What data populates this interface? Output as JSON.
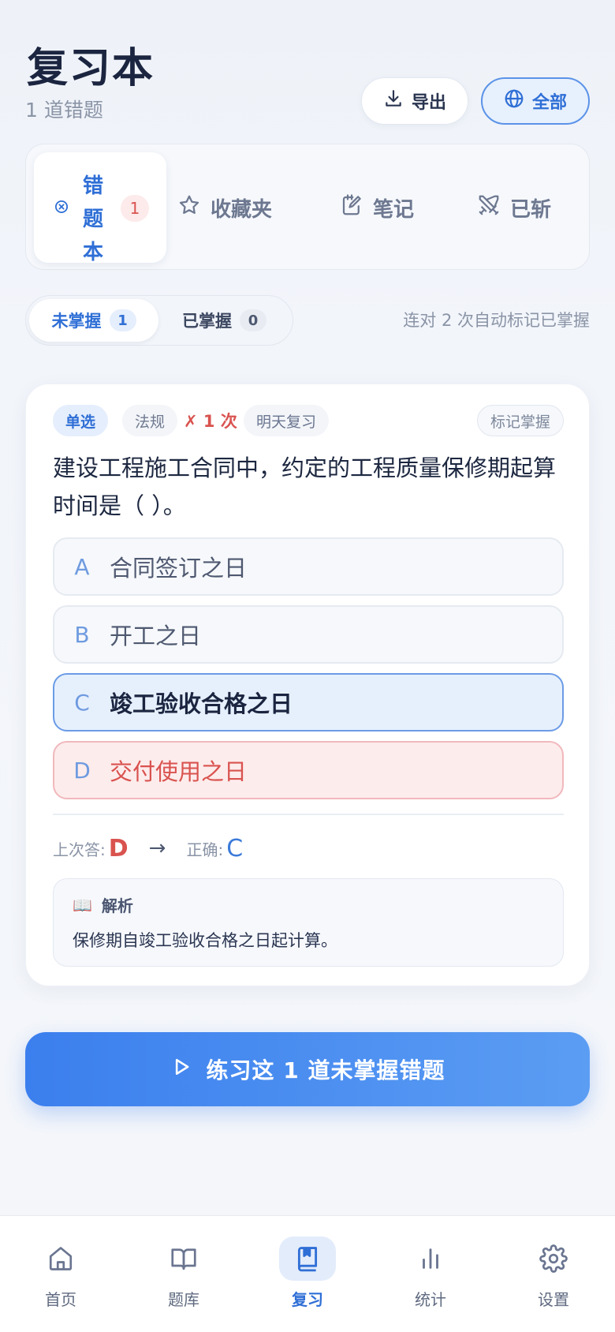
{
  "header": {
    "title": "复习本",
    "subtitle": "1 道错题",
    "export_label": "导出",
    "scope_label": "全部"
  },
  "tabs": [
    {
      "label": "错题本",
      "count": "1",
      "icon": "x-circle-icon",
      "active": true
    },
    {
      "label": "收藏夹",
      "icon": "star-icon"
    },
    {
      "label": "笔记",
      "icon": "note-edit-icon"
    },
    {
      "label": "已斩",
      "icon": "swords-icon"
    }
  ],
  "filter": {
    "unmastered_label": "未掌握",
    "unmastered_count": "1",
    "mastered_label": "已掌握",
    "mastered_count": "0",
    "hint": "连对 2 次自动标记已掌握"
  },
  "question": {
    "type_tag": "单选",
    "category_tag": "法规",
    "wrong_count": "✗ 1 次",
    "review_tag": "明天复习",
    "mark_button": "标记掌握",
    "text": "建设工程施工合同中，约定的工程质量保修期起算时间是（ ）。",
    "options": [
      {
        "letter": "A",
        "text": "合同签订之日",
        "state": "normal"
      },
      {
        "letter": "B",
        "text": "开工之日",
        "state": "normal"
      },
      {
        "letter": "C",
        "text": "竣工验收合格之日",
        "state": "correct"
      },
      {
        "letter": "D",
        "text": "交付使用之日",
        "state": "wrong"
      }
    ],
    "last_answer_label": "上次答:",
    "last_answer": "D",
    "arrow": "→",
    "correct_label": "正确:",
    "correct_answer": "C",
    "explain_icon": "📖",
    "explain_title": "解析",
    "explain_text": "保修期自竣工验收合格之日起计算。"
  },
  "practice_button": "练习这 1 道未掌握错题",
  "nav": [
    {
      "label": "首页",
      "icon": "home-icon"
    },
    {
      "label": "题库",
      "icon": "book-open-icon"
    },
    {
      "label": "复习",
      "icon": "bookmark-book-icon",
      "active": true
    },
    {
      "label": "统计",
      "icon": "bar-chart-icon"
    },
    {
      "label": "设置",
      "icon": "gear-icon"
    }
  ],
  "colors": {
    "accent": "#2f6fd6",
    "danger": "#d9534f",
    "button_gradient_start": "#3b7fee",
    "button_gradient_end": "#5b9df3"
  }
}
